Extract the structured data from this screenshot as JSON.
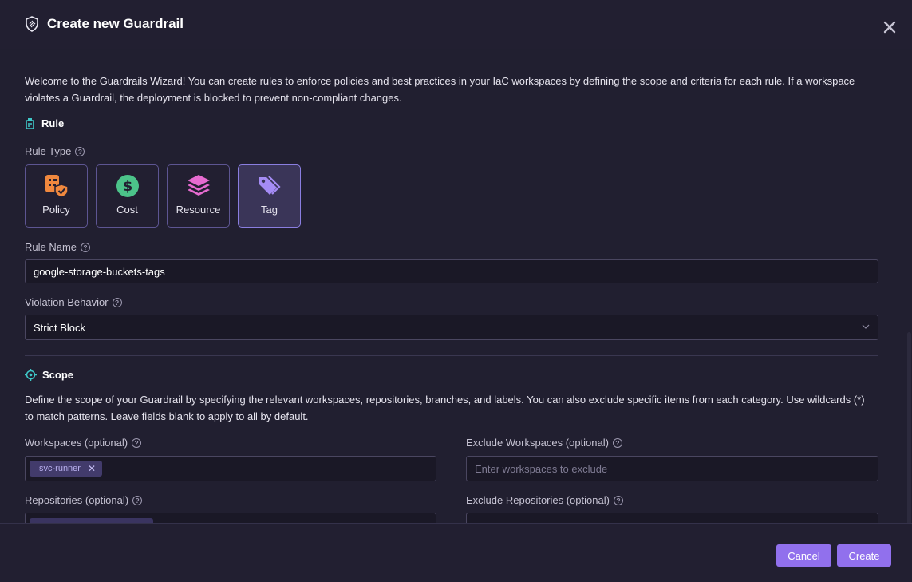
{
  "header": {
    "title": "Create new Guardrail"
  },
  "intro": "Welcome to the Guardrails Wizard! You can create rules to enforce policies and best practices in your IaC workspaces by defining the scope and criteria for each rule. If a workspace violates a Guardrail, the deployment is blocked to prevent non-compliant changes.",
  "rule": {
    "title": "Rule",
    "type_label": "Rule Type",
    "types": [
      {
        "label": "Policy",
        "icon": "policy-icon",
        "color": "#f0883e"
      },
      {
        "label": "Cost",
        "icon": "dollar-icon",
        "color": "#4cc38a"
      },
      {
        "label": "Resource",
        "icon": "layers-icon",
        "color": "#e66bd0"
      },
      {
        "label": "Tag",
        "icon": "tag-icon",
        "color": "#a58cf5",
        "selected": true
      }
    ],
    "name_label": "Rule Name",
    "name_value": "google-storage-buckets-tags",
    "violation_label": "Violation Behavior",
    "violation_value": "Strict Block"
  },
  "scope": {
    "title": "Scope",
    "description": "Define the scope of your Guardrail by specifying the relevant workspaces, repositories, branches, and labels. You can also exclude specific items from each category. Use wildcards (*) to match patterns. Leave fields blank to apply to all by default.",
    "workspaces_label": "Workspaces (optional)",
    "workspaces_chips": [
      "svc-runner"
    ],
    "exclude_workspaces_label": "Exclude Workspaces (optional)",
    "exclude_workspaces_placeholder": "Enter workspaces to exclude",
    "repositories_label": "Repositories (optional)",
    "exclude_repositories_label": "Exclude Repositories (optional)"
  },
  "footer": {
    "cancel_label": "Cancel",
    "create_label": "Create"
  },
  "colors": {
    "accent": "#9170ed",
    "background": "#211f30",
    "chip_bg": "#423b6b"
  }
}
